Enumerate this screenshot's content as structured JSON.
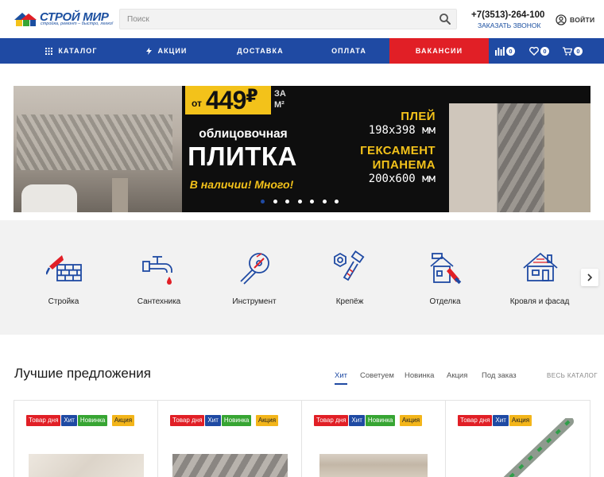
{
  "header": {
    "logo_title": "СТРОЙ МИР",
    "logo_sub": "стройка, ремонт – быстро, легко!",
    "search_placeholder": "Поиск",
    "phone": "+7(3513)-264-100",
    "callback": "ЗАКАЗАТЬ ЗВОНОК",
    "login": "ВОЙТИ"
  },
  "nav": {
    "items": [
      "КАТАЛОГ",
      "АКЦИИ",
      "ДОСТАВКА",
      "ОПЛАТА",
      "ВАКАНСИИ"
    ],
    "compare_count": "0",
    "favorites_count": "0",
    "cart_count": "0"
  },
  "banner": {
    "price_prefix": "от",
    "price": "449",
    "currency": "₽",
    "per_line1": "ЗА",
    "per_line2": "М²",
    "headline1": "облицовочная",
    "headline2": "ПЛИТКА",
    "headline3": "В наличии! Много!",
    "product1_name": "ПЛЕЙ",
    "product1_size": "198х398 мм",
    "product2_name_line1": "ГЕКСАМЕНТ",
    "product2_name_line2": "ИПАНЕМА",
    "product2_size": "200х600 мм",
    "slides_total": 7,
    "slide_active": 1
  },
  "categories": [
    "Стройка",
    "Сантехника",
    "Инструмент",
    "Крепёж",
    "Отделка",
    "Кровля и фасад"
  ],
  "offers": {
    "title": "Лучшие предложения",
    "tabs": [
      "Хит",
      "Советуем",
      "Новинка",
      "Акция",
      "Под заказ"
    ],
    "active_tab": "Хит",
    "all_catalog": "ВЕСЬ КАТАЛОГ",
    "tag_labels": {
      "day": "Товар дня",
      "hit": "Хит",
      "new": "Новинка",
      "sale": "Акция"
    }
  },
  "colors": {
    "brand_blue": "#1f4aa3",
    "accent_red": "#e11f26",
    "accent_yellow": "#f3c21a",
    "tag_green": "#37a533"
  }
}
